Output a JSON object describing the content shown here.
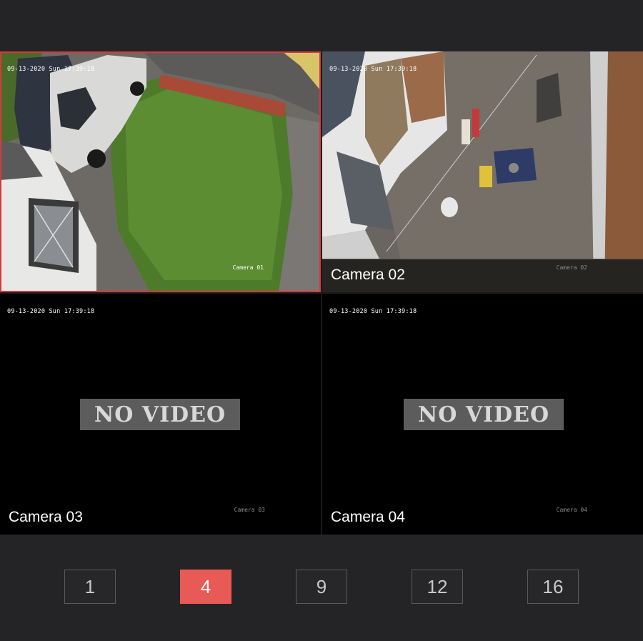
{
  "cameras": [
    {
      "timestamp": "09-13-2020 Sun 17:39:18",
      "osd_name": "Camera 01",
      "label": "",
      "status": "live"
    },
    {
      "timestamp": "09-13-2020 Sun 17:39:18",
      "osd_name": "Camera 02",
      "label": "Camera 02",
      "status": "live"
    },
    {
      "timestamp": "09-13-2020 Sun 17:39:18",
      "osd_name": "Camera 03",
      "label": "Camera 03",
      "status": "NO VIDEO"
    },
    {
      "timestamp": "09-13-2020 Sun 17:39:18",
      "osd_name": "Camera 04",
      "label": "Camera 04",
      "status": "NO VIDEO"
    }
  ],
  "layout_buttons": [
    {
      "label": "1",
      "active": false
    },
    {
      "label": "4",
      "active": true
    },
    {
      "label": "9",
      "active": false
    },
    {
      "label": "12",
      "active": false
    },
    {
      "label": "16",
      "active": false
    }
  ],
  "colors": {
    "selected_border": "#d7393c",
    "active_button": "#e85a55",
    "background": "#232325"
  }
}
